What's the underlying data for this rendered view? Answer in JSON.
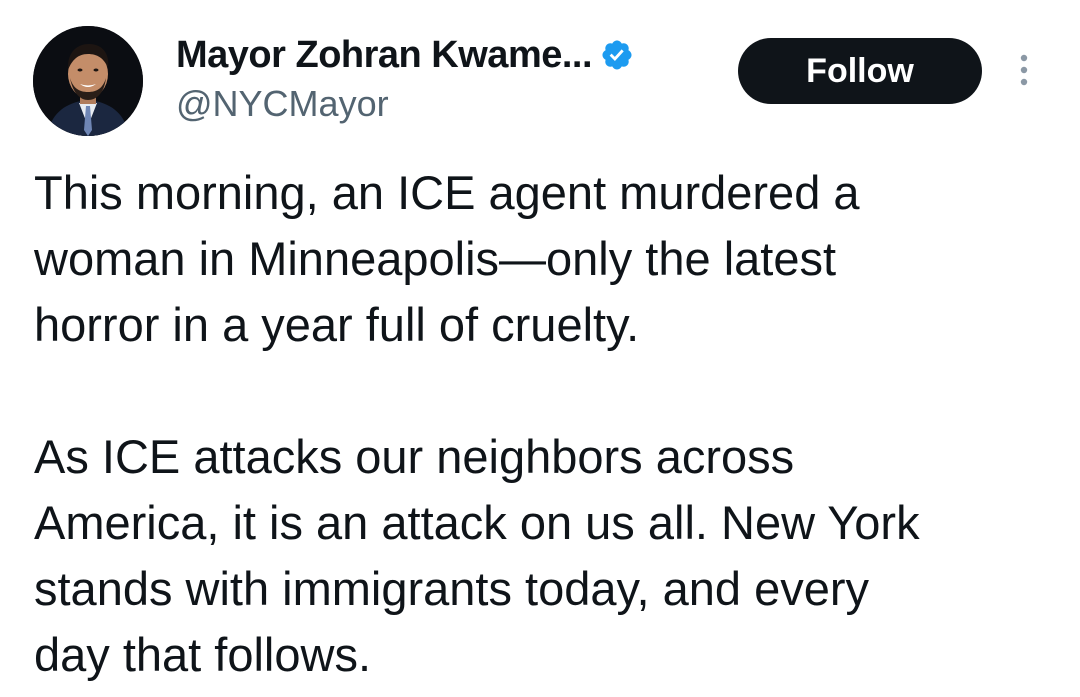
{
  "author": {
    "display_name": "Mayor Zohran Kwame...",
    "handle": "@NYCMayor",
    "verified": true,
    "avatar_icon": "profile-photo"
  },
  "actions": {
    "follow_label": "Follow",
    "more_icon": "more-vertical-icon"
  },
  "tweet": {
    "paragraph1_lines": [
      "This morning, an ICE agent murdered a",
      "woman in Minneapolis—only the latest",
      "horror in a year full of cruelty."
    ],
    "paragraph2_lines": [
      "As ICE attacks our neighbors across",
      "America, it is an attack on us all. New York",
      "stands with immigrants today, and every",
      "day that follows."
    ]
  },
  "colors": {
    "text_primary": "#0f1419",
    "text_secondary": "#536471",
    "verified_blue": "#1d9bf0",
    "follow_button_bg": "#0f1419",
    "follow_button_text": "#ffffff"
  }
}
